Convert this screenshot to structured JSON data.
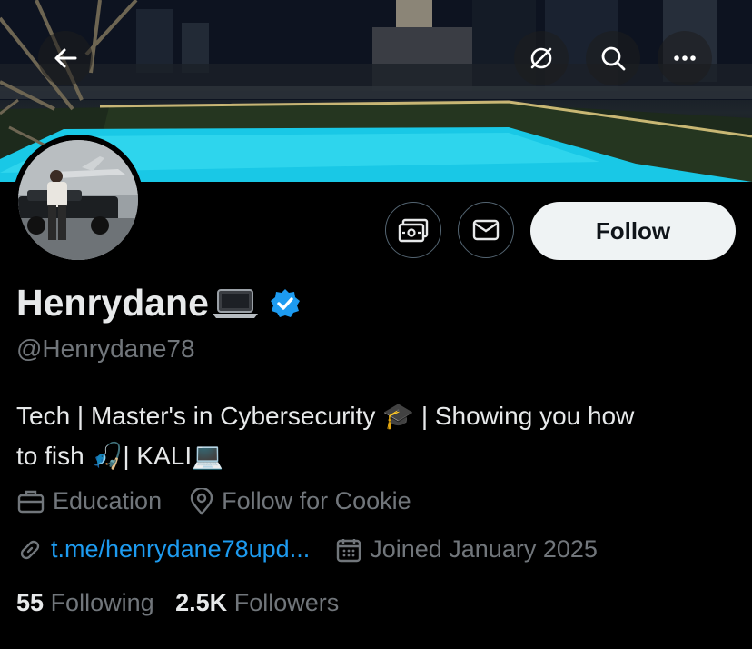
{
  "banner": {
    "back_icon": "back-arrow-icon",
    "grok_icon": "grok-icon",
    "search_icon": "search-icon",
    "more_icon": "more-dots-icon"
  },
  "actions": {
    "tip_icon": "money-tip-icon",
    "message_icon": "envelope-icon",
    "follow_label": "Follow"
  },
  "profile": {
    "display_name": "Henrydane",
    "handle": "@Henrydane78",
    "bio_line1": "Tech | Master's in Cybersecurity 🎓 | Showing you how",
    "bio_line2": "to fish 🎣| KALI💻",
    "category": "Education",
    "location": "Follow for Cookie",
    "link": "t.me/henrydane78upd...",
    "joined": "Joined January 2025"
  },
  "stats": {
    "following_count": "55",
    "following_label": "Following",
    "followers_count": "2.5K",
    "followers_label": "Followers"
  },
  "colors": {
    "accent": "#1d9bf0",
    "muted": "#71767b",
    "text": "#e7e9ea",
    "follow_bg": "#eff3f4"
  }
}
